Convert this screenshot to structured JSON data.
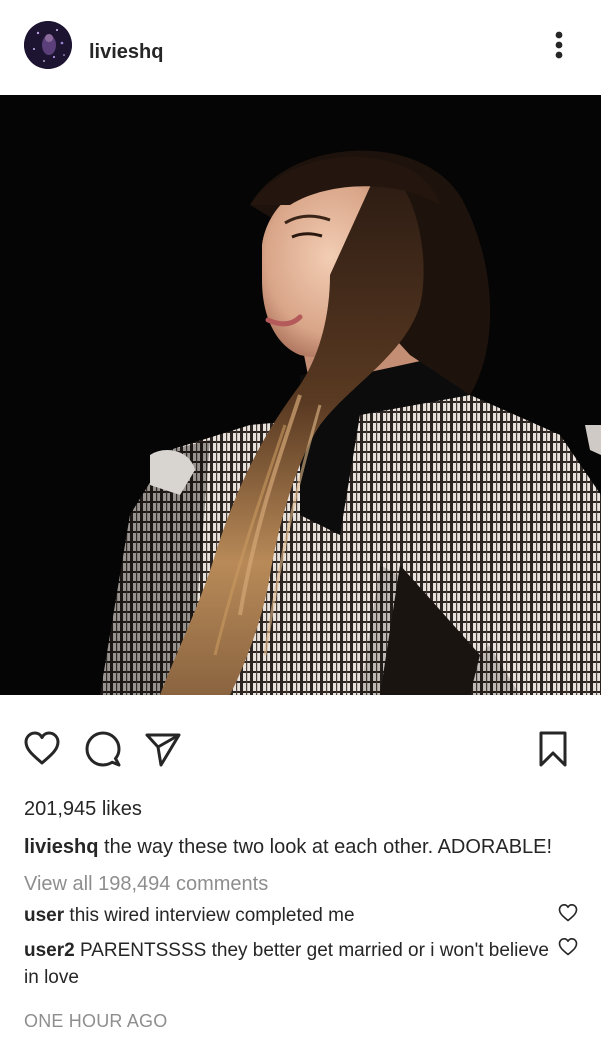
{
  "header": {
    "username": "livieshq"
  },
  "post": {
    "image_description_icon": "photo"
  },
  "actions": {
    "like_icon": "heart-outline",
    "comment_icon": "speech-bubble-outline",
    "share_icon": "paper-plane-outline",
    "save_icon": "bookmark-outline"
  },
  "likes": "201,945 likes",
  "caption": {
    "username": "livieshq",
    "text": " the way these two look at each other. ADORABLE!"
  },
  "view_comments": "View all 198,494 comments",
  "comments": [
    {
      "username": "user",
      "text": " this wired interview completed me"
    },
    {
      "username": "user2",
      "text": " PARENTSSSS they better get married or i won't believe in love"
    }
  ],
  "timestamp": "ONE HOUR AGO",
  "colors": {
    "text_primary": "#262626",
    "text_secondary": "#8e8e8e",
    "background": "#ffffff",
    "photo_background": "#050505"
  }
}
